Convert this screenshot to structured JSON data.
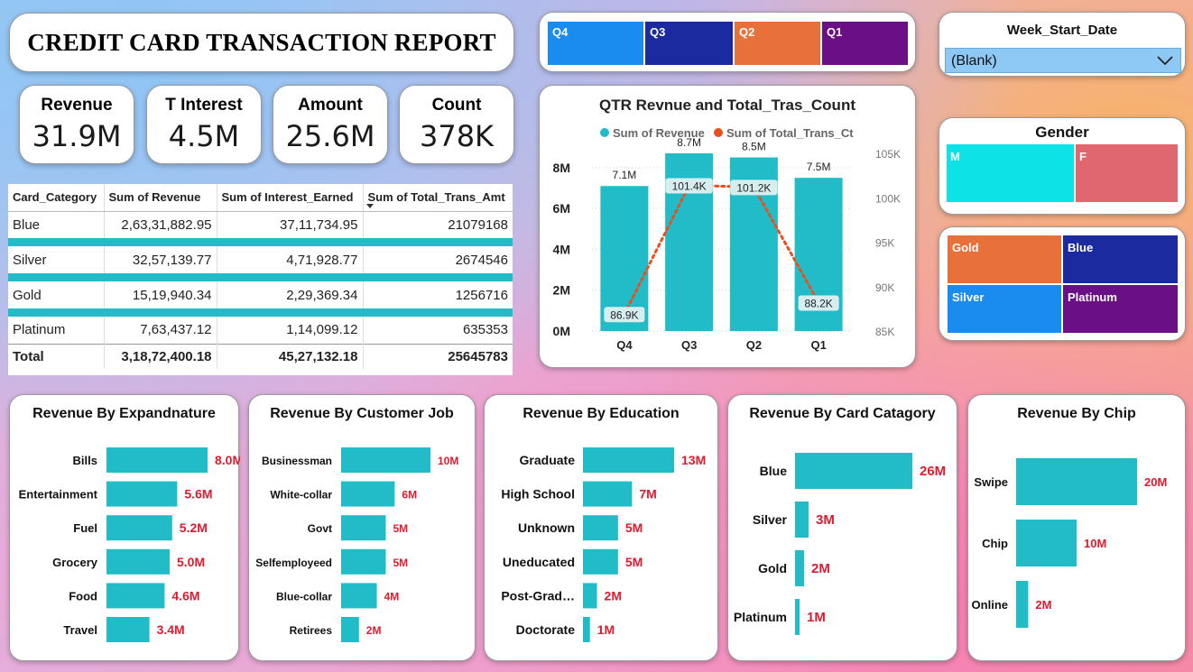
{
  "report_title": "CREDIT CARD TRANSACTION REPORT",
  "kpis": [
    {
      "label": "Revenue",
      "value": "31.9M"
    },
    {
      "label": "T Interest",
      "value": "4.5M"
    },
    {
      "label": "Amount",
      "value": "25.6M"
    },
    {
      "label": "Count",
      "value": "378K"
    }
  ],
  "table": {
    "headers": [
      "Card_Category",
      "Sum of Revenue",
      "Sum of Interest_Earned",
      "Sum of Total_Trans_Amt"
    ],
    "rows": [
      [
        "Blue",
        "2,63,31,882.95",
        "37,11,734.95",
        "21079168"
      ],
      [
        "Silver",
        "32,57,139.77",
        "4,71,928.77",
        "2674546"
      ],
      [
        "Gold",
        "15,19,940.34",
        "2,29,369.34",
        "1256716"
      ],
      [
        "Platinum",
        "7,63,437.12",
        "1,14,099.12",
        "635353"
      ]
    ],
    "total": [
      "Total",
      "3,18,72,400.18",
      "45,27,132.18",
      "25645783"
    ]
  },
  "quarter_slicer": {
    "items": [
      {
        "label": "Q4",
        "color": "#1a8cf0"
      },
      {
        "label": "Q3",
        "color": "#1b2a9e"
      },
      {
        "label": "Q2",
        "color": "#e8703a"
      },
      {
        "label": "Q1",
        "color": "#6a0f86"
      }
    ]
  },
  "week_slicer": {
    "title": "Week_Start_Date",
    "selected": "(Blank)"
  },
  "gender_slicer": {
    "title": "Gender",
    "items": [
      {
        "label": "M",
        "color": "#0de3e6"
      },
      {
        "label": "F",
        "color": "#e06670"
      }
    ]
  },
  "card_category_slicer": {
    "items": [
      {
        "label": "Gold",
        "color": "#e8703a"
      },
      {
        "label": "Blue",
        "color": "#1b2a9e"
      },
      {
        "label": "Silver",
        "color": "#1a8cf0"
      },
      {
        "label": "Platinum",
        "color": "#6a0f86"
      }
    ]
  },
  "chart_data": [
    {
      "type": "bar+line",
      "title": "QTR Revnue and Total_Tras_Count",
      "legend": [
        "Sum of Revenue",
        "Sum of Total_Trans_Ct"
      ],
      "legend_position": "top",
      "categories": [
        "Q4",
        "Q3",
        "Q2",
        "Q1"
      ],
      "series": [
        {
          "name": "Sum of Revenue",
          "axis": "left",
          "values": [
            7.1,
            8.7,
            8.5,
            7.5
          ],
          "labels": [
            "7.1M",
            "8.7M",
            "8.5M",
            "7.5M"
          ],
          "color": "#21bcc8"
        },
        {
          "name": "Sum of Total_Trans_Ct",
          "axis": "right",
          "values": [
            86.9,
            101.4,
            101.2,
            88.2
          ],
          "labels": [
            "86.9K",
            "101.4K",
            "101.2K",
            "88.2K"
          ],
          "color": "#e8501e"
        }
      ],
      "y_left": {
        "ticks": [
          "0M",
          "2M",
          "4M",
          "6M",
          "8M"
        ],
        "lim": [
          0,
          8.7
        ]
      },
      "y_right": {
        "ticks": [
          "85K",
          "90K",
          "95K",
          "100K",
          "105K"
        ],
        "lim": [
          85,
          105
        ]
      },
      "grid": true
    },
    {
      "type": "bar",
      "orientation": "horizontal",
      "title": "Revenue By Expandnature",
      "categories": [
        "Bills",
        "Entertainment",
        "Fuel",
        "Grocery",
        "Food",
        "Travel"
      ],
      "values": [
        8.0,
        5.6,
        5.2,
        5.0,
        4.6,
        3.4
      ],
      "labels": [
        "8.0M",
        "5.6M",
        "5.2M",
        "5.0M",
        "4.6M",
        "3.4M"
      ]
    },
    {
      "type": "bar",
      "orientation": "horizontal",
      "title": "Revenue By Customer Job",
      "categories": [
        "Businessman",
        "White-collar",
        "Govt",
        "Selfemployeed",
        "Blue-collar",
        "Retirees"
      ],
      "values": [
        10,
        6,
        5,
        5,
        4,
        2
      ],
      "labels": [
        "10M",
        "6M",
        "5M",
        "5M",
        "4M",
        "2M"
      ]
    },
    {
      "type": "bar",
      "orientation": "horizontal",
      "title": "Revenue By Education",
      "categories": [
        "Graduate",
        "High School",
        "Unknown",
        "Uneducated",
        "Post-Grad…",
        "Doctorate"
      ],
      "values": [
        13,
        7,
        5,
        5,
        2,
        1
      ],
      "labels": [
        "13M",
        "7M",
        "5M",
        "5M",
        "2M",
        "1M"
      ]
    },
    {
      "type": "bar",
      "orientation": "horizontal",
      "title": "Revenue By Card Catagory",
      "categories": [
        "Blue",
        "Silver",
        "Gold",
        "Platinum"
      ],
      "values": [
        26,
        3,
        2,
        1
      ],
      "labels": [
        "26M",
        "3M",
        "2M",
        "1M"
      ]
    },
    {
      "type": "bar",
      "orientation": "horizontal",
      "title": "Revenue By Chip",
      "categories": [
        "Swipe",
        "Chip",
        "Online"
      ],
      "values": [
        20,
        10,
        2
      ],
      "labels": [
        "20M",
        "10M",
        "2M"
      ]
    }
  ],
  "colors": {
    "bar": "#21bcc8",
    "value_label": "#e01b2e",
    "line": "#e8501e"
  }
}
